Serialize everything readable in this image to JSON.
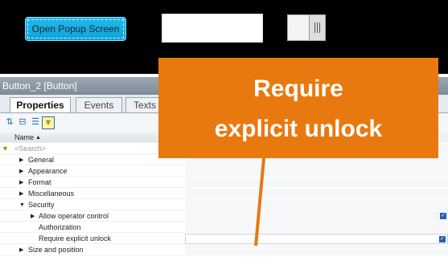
{
  "topbar": {
    "popup_button_label": "Open Popup Screen"
  },
  "panel": {
    "title": "Button_2 [Button]",
    "tabs": [
      "Properties",
      "Events",
      "Texts"
    ],
    "column_header": "Name",
    "search_placeholder": "<Search>",
    "rows": [
      "General",
      "Appearance",
      "Format",
      "Miscellaneous",
      "Security",
      "Allow operator control",
      "Authorization",
      "Require explicit unlock",
      "Size and position"
    ]
  },
  "callout": {
    "line1": "Require",
    "line2": "explicit unlock"
  },
  "colors": {
    "accent": "#e8790f",
    "button": "#12a8dd"
  },
  "icons": [
    "sort-az-icon",
    "collapse-icon",
    "list-icon",
    "filter-icon",
    "filter-clear-icon",
    "chevron-right-icon",
    "chevron-down-icon",
    "checkbox-checked-icon"
  ]
}
